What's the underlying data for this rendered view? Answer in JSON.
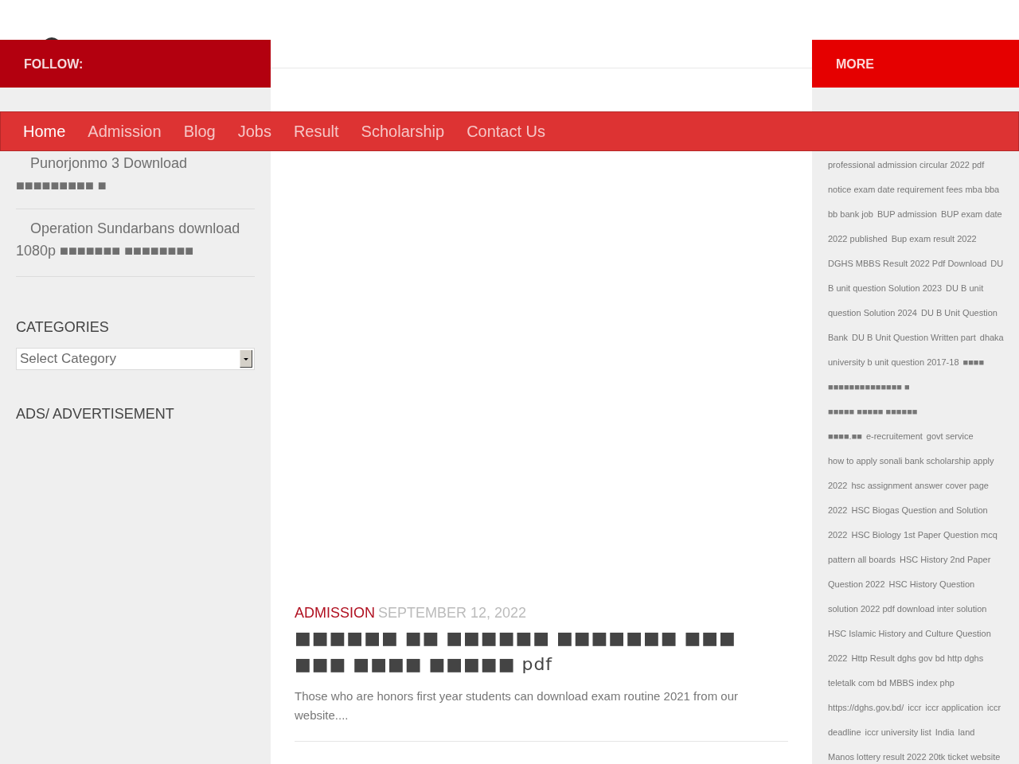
{
  "header": {
    "follow_label": "FOLLOW:",
    "more_label": "MORE"
  },
  "nav": [
    {
      "label": "Home",
      "selected": true
    },
    {
      "label": "Admission",
      "selected": false
    },
    {
      "label": "Blog",
      "selected": false
    },
    {
      "label": "Jobs",
      "selected": false
    },
    {
      "label": "Result",
      "selected": false
    },
    {
      "label": "Scholarship",
      "selected": false
    },
    {
      "label": "Contact Us",
      "selected": false
    }
  ],
  "sidebar": {
    "recent_posts": [
      {
        "title": "Punorjonmo 3 Download ■■■■■■■■■ ■"
      },
      {
        "title": "Operation Sundarbans download 1080p ■■■■■■■ ■■■■■■■■"
      }
    ],
    "categories_title": "CATEGORIES",
    "category_select": {
      "value": "Select Category"
    },
    "ads_title": "ADS/ ADVERTISEMENT"
  },
  "post": {
    "category": "ADMISSION",
    "date": "SEPTEMBER 12, 2022",
    "title": "■■■■■■ ■■ ■■■■■■ ■■■■■■■ ■■■ ■■■ ■■■■ ■■■■■ pdf",
    "excerpt": "Those who are honors first year students can download exam routine 2021 from our website...."
  },
  "tag_cloud": {
    "lines": [
      {
        "links": [
          "professional admission circular 2022 pdf"
        ]
      },
      {
        "links": [
          "notice exam date requirement fees mba bba"
        ]
      },
      {
        "links": [
          "bb bank job",
          "BUP admission",
          "BUP exam date"
        ]
      },
      {
        "links": [
          "2022 published",
          "Bup exam result 2022"
        ]
      },
      {
        "links": [
          "DGHS MBBS Result 2022 Pdf Download",
          "DU"
        ]
      },
      {
        "links": [
          "B unit question Solution 2023",
          "DU B unit"
        ]
      },
      {
        "links": [
          "question Solution 2024",
          "DU B Unit Question"
        ]
      },
      {
        "links": [
          "Bank",
          "DU B Unit Question Written part",
          "dhaka"
        ]
      },
      {
        "links": [
          "university b unit question 2017-18",
          "■■■■"
        ]
      },
      {
        "links": [
          "■■■■■■■■■■■■■■ ■"
        ]
      },
      {
        "links": [
          "■■■■■ ■■■■■ ■■■■■■"
        ]
      },
      {
        "links": [
          "■■■■.■■",
          "e-recruitement",
          "govt service"
        ]
      },
      {
        "links": [
          "how to apply sonali bank scholarship apply"
        ]
      },
      {
        "links": [
          "2022",
          "hsc assignment answer cover page"
        ]
      },
      {
        "links": [
          "2022",
          "HSC Biogas Question and Solution"
        ]
      },
      {
        "links": [
          "2022",
          "HSC Biology 1st Paper Question mcq"
        ]
      },
      {
        "links": [
          "pattern all boards",
          "HSC History 2nd Paper"
        ]
      },
      {
        "links": [
          "Question 2022",
          "HSC History Question"
        ]
      },
      {
        "links": [
          "solution 2022 pdf download inter solution"
        ]
      },
      {
        "links": [
          "HSC Islamic History and Culture Question"
        ]
      },
      {
        "links": [
          "2022",
          "Http Result dghs gov bd http dghs"
        ]
      },
      {
        "links": [
          "teletalk com bd MBBS index php"
        ]
      },
      {
        "links": [
          "https://dghs.gov.bd/",
          "iccr",
          "iccr application",
          "iccr"
        ]
      },
      {
        "links": [
          "deadline",
          "iccr university list",
          "India",
          "land"
        ]
      },
      {
        "links": [
          "Manos lottery result 2022 20tk ticket website"
        ]
      }
    ]
  }
}
